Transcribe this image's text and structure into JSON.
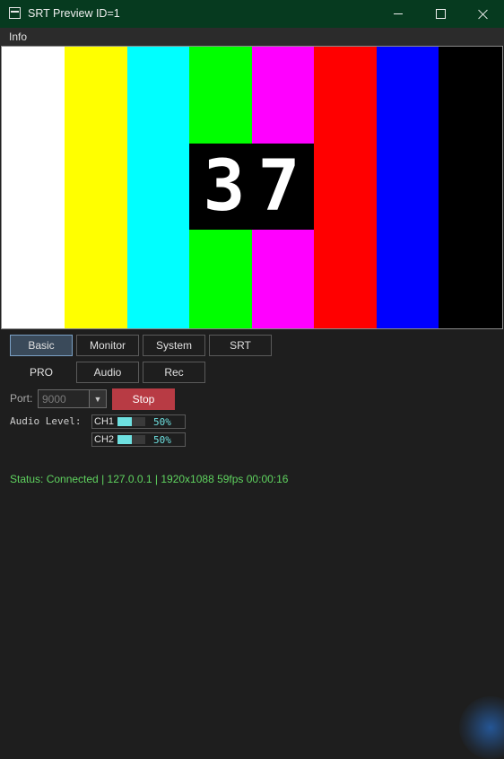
{
  "window": {
    "title": "SRT Preview ID=1",
    "titlebar_color": "#063a1f"
  },
  "menu": {
    "items": [
      "Info"
    ]
  },
  "preview": {
    "counter": "37",
    "bars": [
      "#ffffff",
      "#ffff00",
      "#00ffff",
      "#00ff00",
      "#ff00ff",
      "#ff0000",
      "#0000ff",
      "#000000"
    ]
  },
  "tabs": [
    {
      "label": "Basic",
      "active": true
    },
    {
      "label": "Monitor",
      "active": false
    },
    {
      "label": "System",
      "active": false
    },
    {
      "label": "SRT",
      "active": false
    },
    {
      "label": "PRO",
      "active": false
    },
    {
      "label": "Audio",
      "active": false
    },
    {
      "label": "Rec",
      "active": false
    }
  ],
  "port": {
    "label": "Port:",
    "value": "9000"
  },
  "stop_button": {
    "label": "Stop",
    "color": "#b83b44"
  },
  "audio": {
    "label": "Audio Level:",
    "channels": [
      {
        "name": "CH1",
        "level": 50,
        "text": "50%"
      },
      {
        "name": "CH2",
        "level": 50,
        "text": "50%"
      }
    ]
  },
  "status": {
    "text": "Status: Connected | 127.0.0.1 | 1920x1088 59fps 00:00:16",
    "color": "#5fd35f"
  }
}
